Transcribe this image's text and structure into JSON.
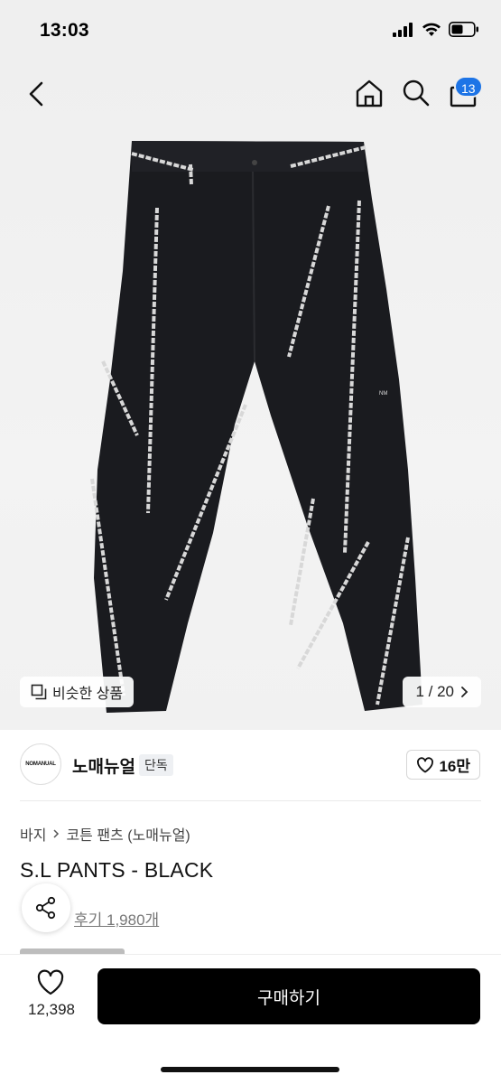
{
  "status_bar": {
    "time": "13:03"
  },
  "nav": {
    "back_icon": "chevron-left-icon",
    "home_icon": "home-icon",
    "search_icon": "search-icon",
    "bag_icon": "shopping-bag-icon",
    "bag_count": "13",
    "badge_color": "#1d74e6"
  },
  "gallery": {
    "similar_label": "비슷한 상품",
    "pager": "1 / 20"
  },
  "brand": {
    "logo_text": "NOMANUAL",
    "name": "노매뉴얼",
    "tag": "단독",
    "likes": "16만"
  },
  "product": {
    "breadcrumb": [
      "바지",
      "코튼 팬츠 (노매뉴얼)"
    ],
    "title": "S.L PANTS - BLACK",
    "review": "후기 1,980개"
  },
  "bottom": {
    "wish_count": "12,398",
    "buy_label": "구매하기",
    "buy_color": "#000000"
  }
}
